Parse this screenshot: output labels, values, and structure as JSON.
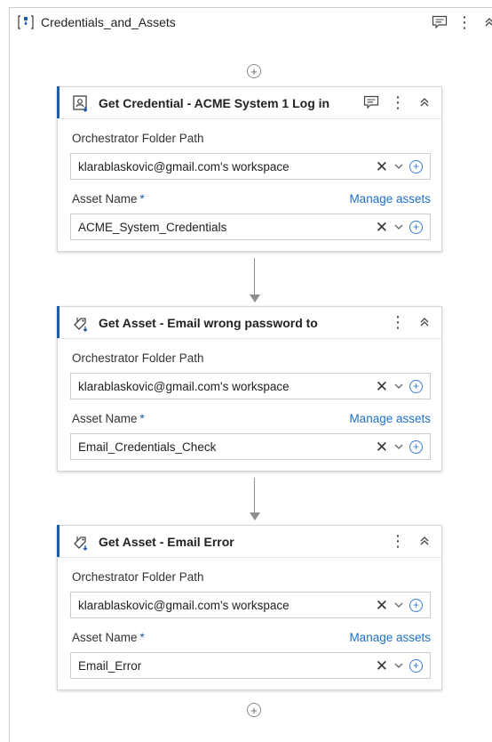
{
  "sequence": {
    "title": "Credentials_and_Assets",
    "icon": "sequence-icon"
  },
  "activities": [
    {
      "title": "Get Credential - ACME System 1 Log in",
      "icon": "credential-icon",
      "has_comment": true,
      "folder_label": "Orchestrator Folder Path",
      "folder_value": "klarablaskovic@gmail.com's workspace",
      "asset_label": "Asset Name",
      "asset_required": "*",
      "manage_label": "Manage assets",
      "asset_value": "ACME_System_Credentials"
    },
    {
      "title": "Get Asset - Email wrong password to",
      "icon": "asset-icon",
      "has_comment": false,
      "folder_label": "Orchestrator Folder Path",
      "folder_value": "klarablaskovic@gmail.com's workspace",
      "asset_label": "Asset Name",
      "asset_required": "*",
      "manage_label": "Manage assets",
      "asset_value": "Email_Credentials_Check"
    },
    {
      "title": "Get Asset - Email Error",
      "icon": "asset-icon",
      "has_comment": false,
      "folder_label": "Orchestrator Folder Path",
      "folder_value": "klarablaskovic@gmail.com's workspace",
      "asset_label": "Asset Name",
      "asset_required": "*",
      "manage_label": "Manage assets",
      "asset_value": "Email_Error"
    }
  ],
  "symbols": {
    "plus": "+",
    "clear": "✕",
    "kebab": "⋮"
  },
  "colors": {
    "accent": "#1f5ca8",
    "link": "#1f6fc5"
  }
}
